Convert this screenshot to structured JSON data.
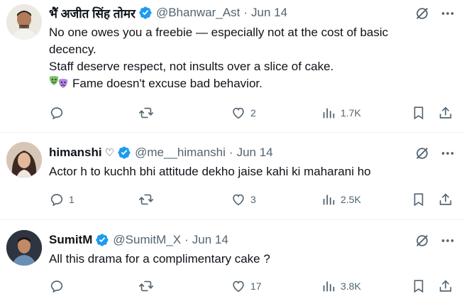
{
  "tweets": [
    {
      "display_name": "भैॅ अजीत सिंह तोमर",
      "handle": "@Bhanwar_Ast",
      "separator": "·",
      "date": "Jun 14",
      "body_lines": [
        "No one owes you a freebie — especially not at the cost of basic",
        "decency.",
        "Staff deserve respect, not insults over a slice of cake."
      ],
      "last_line_text": "Fame doesn't excuse bad behavior.",
      "last_line_emoji": "performing-arts-masks",
      "reply_count": "",
      "retweet_count": "",
      "like_count": "2",
      "view_count": "1.7K"
    },
    {
      "display_name": "himanshi",
      "name_suffix": "♡",
      "handle": "@me__himanshi",
      "separator": "·",
      "date": "Jun 14",
      "body_lines": [
        "Actor h to kuchh bhi attitude dekho jaise kahi ki maharani ho"
      ],
      "reply_count": "1",
      "retweet_count": "",
      "like_count": "3",
      "view_count": "2.5K"
    },
    {
      "display_name": "SumitM",
      "handle": "@SumitM_X",
      "separator": "·",
      "date": "Jun 14",
      "body_lines": [
        "All this drama for a complimentary cake ?"
      ],
      "reply_count": "",
      "retweet_count": "",
      "like_count": "17",
      "view_count": "3.8K"
    }
  ],
  "icons": {
    "verified": "verified-badge-icon",
    "grok": "grok-icon",
    "more": "more-icon",
    "reply": "reply-icon",
    "retweet": "retweet-icon",
    "like": "like-icon",
    "views": "views-icon",
    "bookmark": "bookmark-icon",
    "share": "share-icon"
  },
  "colors": {
    "verified_blue": "#1d9bf0",
    "text_primary": "#0f1419",
    "text_secondary": "#536471",
    "divider": "#eff3f4"
  }
}
